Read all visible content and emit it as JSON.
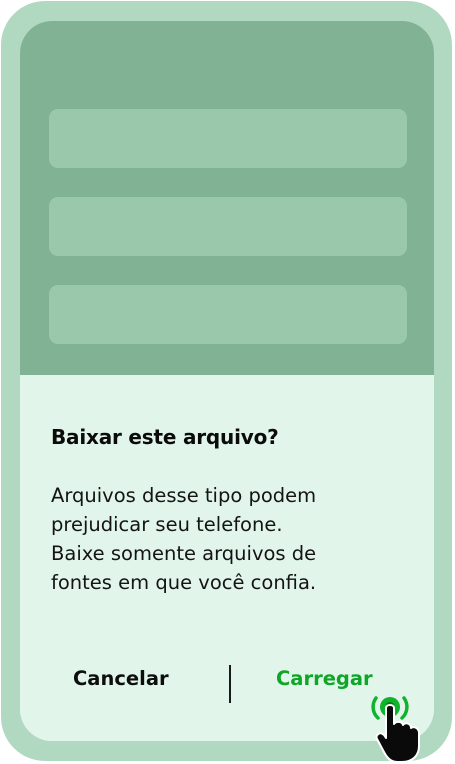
{
  "dialog": {
    "title": "Baixar este arquivo?",
    "body_lines": [
      "Arquivos desse tipo podem",
      "prejudicar seu telefone.",
      "Baixe somente arquivos de",
      "fontes em que você confia."
    ],
    "cancel_label": "Cancelar",
    "load_label": "Carregar"
  },
  "colors": {
    "frame": "#b1d9c2",
    "backdrop": "#80b293",
    "placeholder": "#9ac8ab",
    "dialog_bg": "#e1f5ea",
    "accent": "#0fa628"
  },
  "icons": {
    "tap": "hand-pointer-icon"
  }
}
